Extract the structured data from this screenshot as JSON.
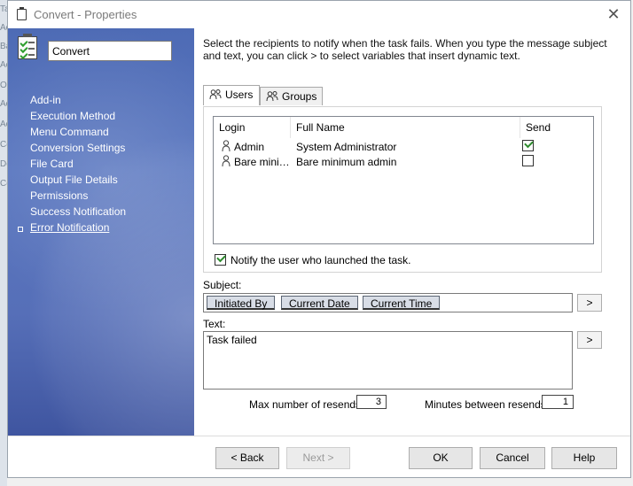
{
  "background_fragments": [
    "Ta",
    "Ac",
    "Ba",
    "Ac",
    "O",
    "Ac",
    "Ac",
    "Co",
    "De",
    "Co"
  ],
  "window": {
    "title": "Convert - Properties",
    "close_glyph": "✕"
  },
  "sidebar": {
    "name_value": "Convert",
    "items": [
      {
        "label": "Add-in"
      },
      {
        "label": "Execution Method"
      },
      {
        "label": "Menu Command"
      },
      {
        "label": "Conversion Settings"
      },
      {
        "label": "File Card"
      },
      {
        "label": "Output File Details"
      },
      {
        "label": "Permissions"
      },
      {
        "label": "Success Notification"
      },
      {
        "label": "Error Notification",
        "active": true
      }
    ]
  },
  "main": {
    "description": "Select the recipients to notify when the task fails. When you type the message subject and text, you can click > to select variables that insert dynamic text.",
    "tabs": [
      {
        "label": "Users",
        "selected": true,
        "icon": "users-icon"
      },
      {
        "label": "Groups",
        "selected": false,
        "icon": "groups-icon"
      }
    ],
    "grid": {
      "columns": [
        "Login",
        "Full Name",
        "Send"
      ],
      "rows": [
        {
          "login": "Admin",
          "full_name": "System Administrator",
          "send": true
        },
        {
          "login": "Bare mini…",
          "full_name": "Bare minimum admin",
          "send": false
        }
      ]
    },
    "notify_label": "Notify the user who launched the task.",
    "notify_checked": true,
    "subject_label": "Subject:",
    "subject_tokens": [
      "Initiated By",
      "Current Date",
      "Current Time"
    ],
    "insert_button": ">",
    "text_label": "Text:",
    "text_value": "Task failed",
    "max_resends_label": "Max number of resends:",
    "max_resends": "3",
    "minutes_label": "Minutes between resends:",
    "minutes": "1"
  },
  "footer": {
    "back": "< Back",
    "next": "Next >",
    "ok": "OK",
    "cancel": "Cancel",
    "help": "Help"
  },
  "colors": {
    "sidebar_blue": "#4e6bb5",
    "check_green": "#2e8b2e"
  }
}
